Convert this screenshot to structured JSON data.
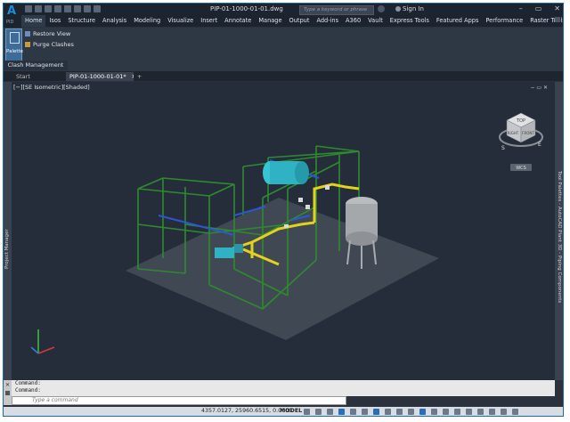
{
  "app": {
    "logo_text": "A",
    "logo_sub": "PID",
    "document_title": "PIP-01-1000-01-01.dwg",
    "search_placeholder": "Type a keyword or phrase",
    "sign_in": "Sign In"
  },
  "menu": {
    "tabs": [
      "Home",
      "Isos",
      "Structure",
      "Analysis",
      "Modeling",
      "Visualize",
      "Insert",
      "Annotate",
      "Manage",
      "Output",
      "Add-ins",
      "A360",
      "Vault",
      "Express Tools",
      "Featured Apps",
      "Performance",
      "Raster Tools"
    ],
    "active_index": 0
  },
  "ribbon": {
    "palette_label": "Palette",
    "restore_view": "Restore View",
    "purge_clashes": "Purge Clashes",
    "panel_title": "Clash Management"
  },
  "file_tabs": {
    "start": "Start",
    "active": "PIP-01-1000-01-01*",
    "add": "+"
  },
  "viewport": {
    "controls": "[−][SE Isometric][Shaded]",
    "viewcube_top": "TOP",
    "viewcube_left": "RIGHT",
    "viewcube_front": "FRONT",
    "wcs": "WCS",
    "compass_s": "S",
    "compass_e": "E",
    "window_controls": "−  ▭  ✕"
  },
  "side_panels": {
    "left": "Project Manager",
    "right": "Tool Palettes - AutoCAD Plant 3D - Piping Components"
  },
  "command": {
    "history": [
      "Command:",
      "Command:"
    ],
    "placeholder": "Type a command"
  },
  "status": {
    "coordinates": "4357.0127, 25960.6515, 0.0000",
    "mode": "MODEL"
  }
}
